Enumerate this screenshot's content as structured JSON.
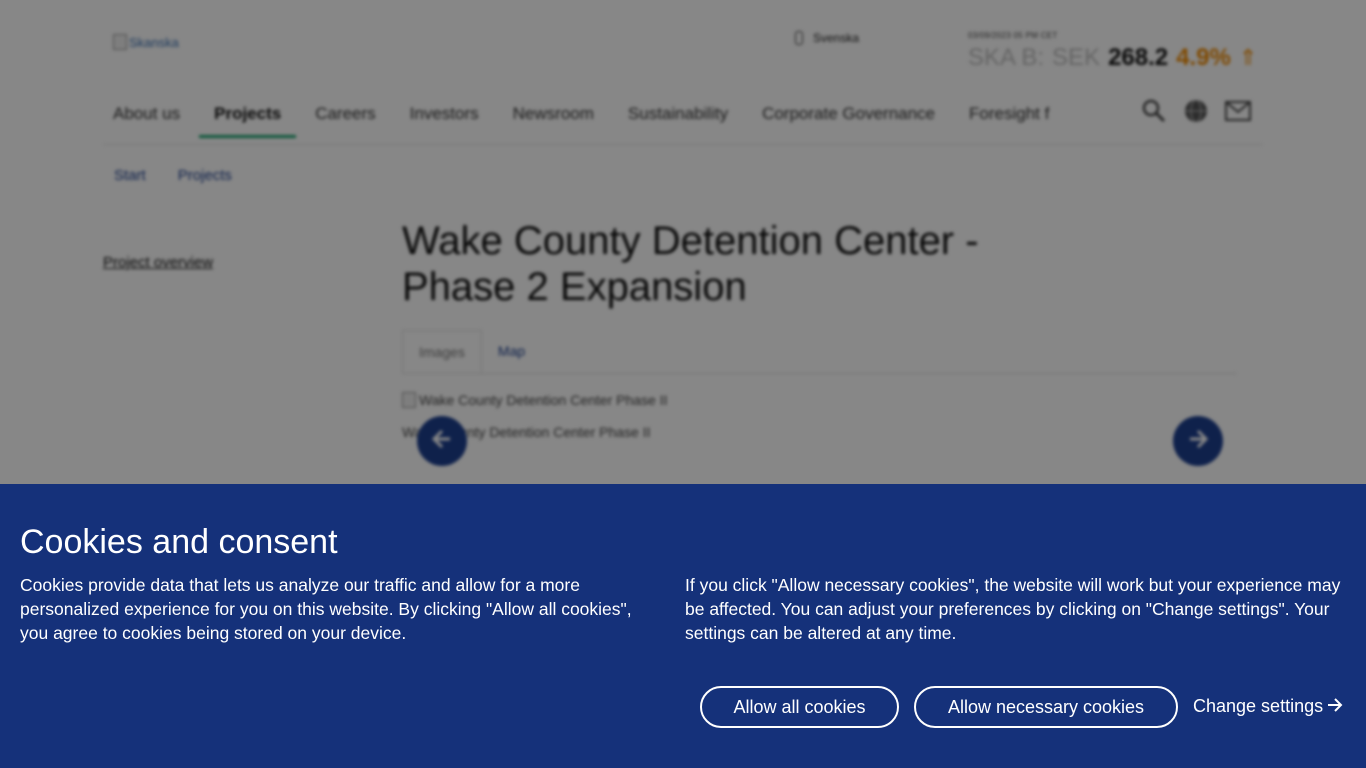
{
  "header": {
    "logo_alt": "Skanska",
    "language": "Svenska",
    "stock": {
      "timestamp": "03/09/2023 05 PM CET",
      "ticker": "SKA B:",
      "currency": "SEK",
      "price": "268.2",
      "change": "4.9%",
      "change_icon": "up-arrow-icon"
    }
  },
  "nav": {
    "items": [
      "About us",
      "Projects",
      "Careers",
      "Investors",
      "Newsroom",
      "Sustainability",
      "Corporate Governance",
      "Foresight f"
    ],
    "active": "Projects",
    "icons": [
      "search-icon",
      "globe-icon",
      "mail-icon"
    ]
  },
  "breadcrumb": [
    "Start",
    "Projects"
  ],
  "sidebar": {
    "link": "Project overview"
  },
  "main": {
    "title": "Wake County Detention Center - Phase 2 Expansion",
    "tabs": [
      "Images",
      "Map"
    ],
    "image_alt": "Wake County Detention Center Phase II",
    "caption": "Wake County Detention Center Phase II"
  },
  "cookie_banner": {
    "title": "Cookies and consent",
    "text_left": "Cookies provide data that lets us analyze our traffic and allow for a more personalized experience for you on this website. By clicking \"Allow all cookies\", you agree to cookies being stored on your device.",
    "text_right": "If you click \"Allow necessary cookies\", the website will work but your experience may be affected. You can adjust your preferences by clicking on \"Change settings\". Your settings can be altered at any time.",
    "allow_all_label": "Allow all cookies",
    "allow_necessary_label": "Allow necessary cookies",
    "change_settings_label": "Change settings",
    "background_color": "#15317a"
  }
}
